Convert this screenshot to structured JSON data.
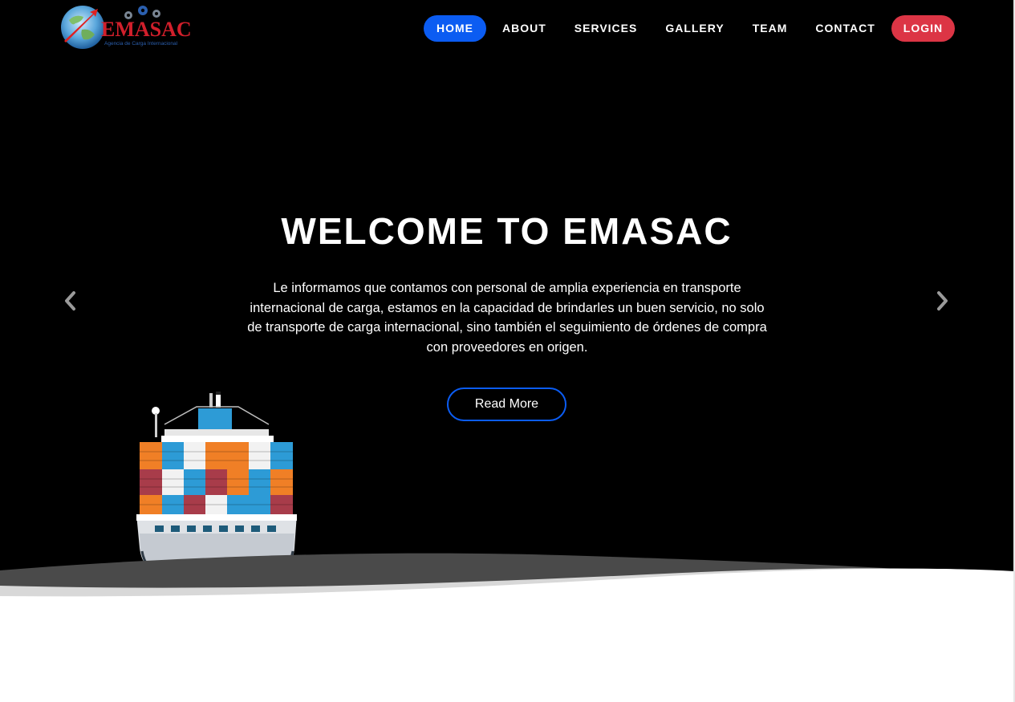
{
  "brand": {
    "name": "EMASAC",
    "tagline": "Agencia de Carga Internacional"
  },
  "nav": {
    "items": [
      {
        "label": "HOME",
        "active": true
      },
      {
        "label": "ABOUT"
      },
      {
        "label": "SERVICES"
      },
      {
        "label": "GALLERY"
      },
      {
        "label": "TEAM"
      },
      {
        "label": "CONTACT"
      }
    ],
    "login_label": "LOGIN"
  },
  "hero": {
    "title": "WELCOME TO EMASAC",
    "text": "Le informamos que contamos con personal de amplia experiencia en transporte internacional de carga, estamos en la capacidad de brindarles un buen servicio, no solo de transporte de carga internacional, sino también el seguimiento de órdenes de compra con proveedores en origen.",
    "button_label": "Read More",
    "prev_icon": "chevron-left-icon",
    "next_icon": "chevron-right-icon"
  },
  "colors": {
    "hero_bg": "#000000",
    "accent": "#0b5cf2",
    "login": "#dc3545"
  }
}
